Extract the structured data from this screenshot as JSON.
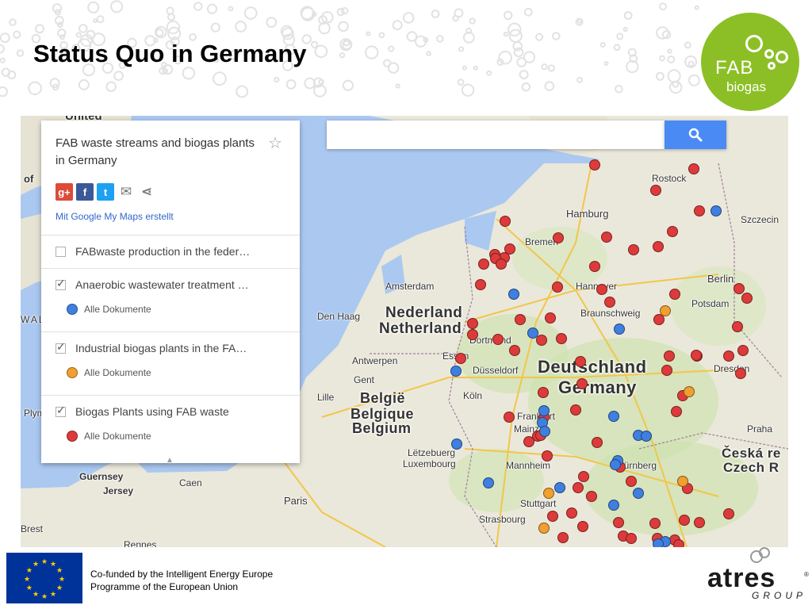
{
  "slide": {
    "title": "Status Quo in Germany"
  },
  "logo": {
    "name": "FAB",
    "sub": "biogas",
    "color": "#8cbf26"
  },
  "map": {
    "search_placeholder": "",
    "search_icon": "search-icon",
    "panel": {
      "title": "FAB waste streams and biogas plants in Germany",
      "star_icon": "star-icon",
      "share_icons": [
        "google-plus-icon",
        "facebook-icon",
        "twitter-icon",
        "email-icon",
        "share-icon"
      ],
      "share_glyphs": [
        "g+",
        "f",
        "t",
        "✉",
        "⋖"
      ],
      "made_with": "Mit Google My Maps erstellt",
      "layers": [
        {
          "label": "FABwaste production in the feder…",
          "checked": false,
          "sub": ""
        },
        {
          "label": "Anaerobic wastewater treatment …",
          "checked": true,
          "sub": "Alle Dokumente",
          "color": "#3f7fe0"
        },
        {
          "label": "Industrial biogas plants in the FA…",
          "checked": true,
          "sub": "Alle Dokumente",
          "color": "#f0a030"
        },
        {
          "label": "Biogas Plants using FAB waste",
          "checked": true,
          "sub": "Alle Dokumente",
          "color": "#dd3b3b"
        }
      ],
      "collapse_glyph": "▲"
    },
    "country_labels": [
      "Nederland",
      "Netherland",
      "Deutschland",
      "Germany",
      "België",
      "Belgique",
      "Belgium",
      "Česká re",
      "Czech R"
    ],
    "city_labels": [
      "Rostock",
      "Szczecin",
      "Hamburg",
      "Bremen",
      "Amsterdam",
      "Hannover",
      "Berlin",
      "Potsdam",
      "Den Haag",
      "Braunschweig",
      "Dortmund",
      "Essen",
      "Antwerpen",
      "Düsseldorf",
      "Gent",
      "Köln",
      "Dresden",
      "Lille",
      "Frankfurt",
      "Mainz",
      "Praha",
      "Lëtzebuerg",
      "Luxembourg",
      "Mannheim",
      "Nürnberg",
      "Guernsey",
      "Jersey",
      "Caen",
      "Stuttgart",
      "Paris",
      "Strasbourg",
      "Brest",
      "Rennes",
      "Plym",
      "of",
      "WAL",
      "United"
    ],
    "markers": {
      "red": 95,
      "blue": 20,
      "orange": 5
    }
  },
  "footer": {
    "funding_line1": "Co-funded by the Intelligent Energy Europe",
    "funding_line2": "Programme of the European Union",
    "eu_flag_icon": "eu-flag-icon",
    "partner_name": "atres",
    "partner_sub": "GROUP",
    "partner_reg": "®"
  }
}
